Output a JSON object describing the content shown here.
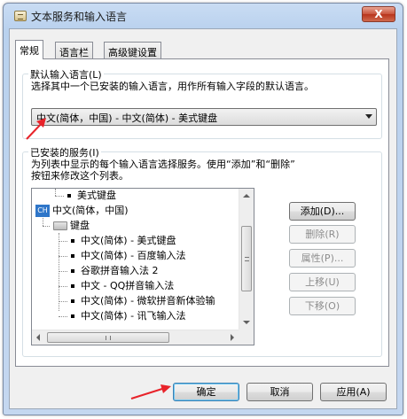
{
  "window": {
    "title": "文本服务和输入语言",
    "close_glyph": "X"
  },
  "tabs": [
    {
      "label": "常规",
      "active": true
    },
    {
      "label": "语言栏",
      "active": false
    },
    {
      "label": "高级键设置",
      "active": false
    }
  ],
  "default_language": {
    "group_label": "默认输入语言(L)",
    "description": "选择其中一个已安装的输入语言，用作所有输入字段的默认语言。",
    "selected_value": "中文(简体，中国) - 中文(简体) - 美式键盘"
  },
  "installed_services": {
    "group_label": "已安装的服务(I)",
    "description_line1": "为列表中显示的每个输入语言选择服务。使用“添加”和“删除”",
    "description_line2": "按钮来修改这个列表。",
    "tree": {
      "partial_item": "美式键盘",
      "language": {
        "badge": "CH",
        "label": "中文(简体，中国)"
      },
      "group": "键盘",
      "items": [
        "中文(简体) - 美式键盘",
        "中文(简体) - 百度输入法",
        "谷歌拼音输入法 2",
        "中文 - QQ拼音输入法",
        "中文(简体) - 微软拼音新体验输",
        "中文(简体) - 讯飞输入法"
      ]
    },
    "buttons": {
      "add": "添加(D)...",
      "remove": "删除(R)",
      "properties": "属性(P)...",
      "move_up": "上移(U)",
      "move_down": "下移(O)"
    }
  },
  "dialog_buttons": {
    "ok": "确定",
    "cancel": "取消",
    "apply": "应用(A)"
  },
  "colors": {
    "annotation_arrow": "#e8232a",
    "icon_badge": "#2f76c9"
  }
}
